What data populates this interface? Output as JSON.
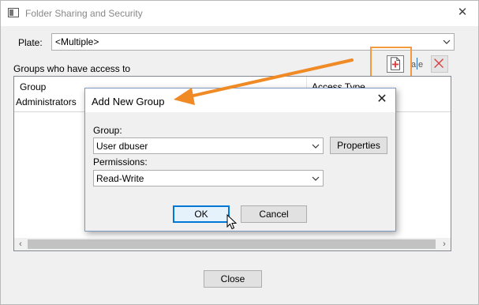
{
  "window": {
    "title": "Folder Sharing and Security",
    "icon": "folder-window-icon",
    "close_glyph": "✕"
  },
  "plate": {
    "label": "Plate:",
    "selected": "<Multiple>"
  },
  "groups_section": {
    "label": "Groups who have access to",
    "toolbar": {
      "add_icon": "add-document-icon",
      "edit_icon": "rename-icon",
      "edit_glyph": "a|e",
      "delete_icon": "delete-x-icon"
    },
    "columns": [
      "Group",
      "Access Type"
    ],
    "rows": [
      {
        "group": "Administrators",
        "access": ""
      }
    ]
  },
  "main_buttons": {
    "close_label": "Close"
  },
  "dialog": {
    "title": "Add New Group",
    "close_glyph": "✕",
    "group_label": "Group:",
    "group_value": "User dbuser",
    "properties_label": "Properties",
    "permissions_label": "Permissions:",
    "permissions_value": "Read-Write",
    "ok_label": "OK",
    "cancel_label": "Cancel"
  },
  "colors": {
    "highlight": "#f29a3c",
    "arrow": "#ef8a25",
    "ok_border": "#0078d7",
    "delete_red": "#d83b3b"
  },
  "scrollbar": {
    "left_glyph": "‹",
    "right_glyph": "›"
  }
}
